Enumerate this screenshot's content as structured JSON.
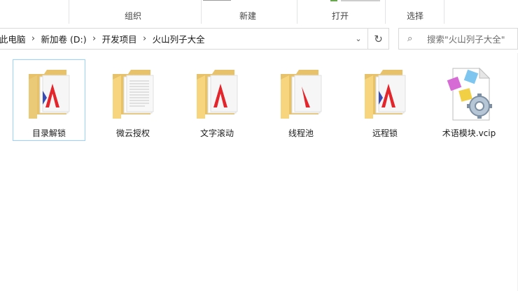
{
  "ribbon": {
    "groups": [
      {
        "label": "组织"
      },
      {
        "label": "新建"
      },
      {
        "label": "打开"
      },
      {
        "label": "选择"
      }
    ],
    "top_fragments": [
      "",
      ""
    ]
  },
  "address": {
    "crumbs": [
      "此电脑",
      "新加卷 (D:)",
      "开发项目",
      "火山列子大全"
    ]
  },
  "search": {
    "placeholder": "搜索\"火山列子大全\""
  },
  "items": [
    {
      "label": "目录解锁",
      "type": "folder",
      "selected": true
    },
    {
      "label": "微云授权",
      "type": "folder-docs",
      "selected": false
    },
    {
      "label": "文字滚动",
      "type": "folder",
      "selected": false
    },
    {
      "label": "线程池",
      "type": "folder",
      "selected": false
    },
    {
      "label": "远程锁",
      "type": "folder",
      "selected": false
    },
    {
      "label": "术语模块.vcip",
      "type": "vcip-file",
      "selected": false
    }
  ],
  "colors": {
    "folder_back": "#e8c26a",
    "folder_front": "#f7d57e",
    "brand_red": "#e3262c",
    "brand_blue": "#3b4bb5",
    "selection_border": "#99d1ff"
  }
}
